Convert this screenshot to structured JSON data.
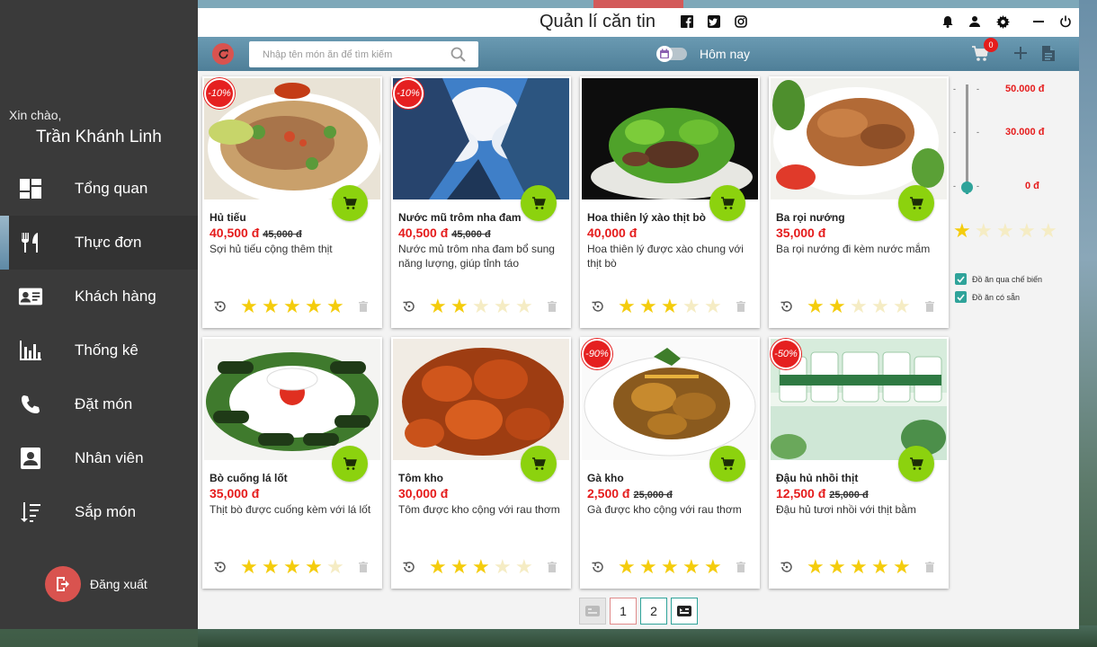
{
  "app": {
    "title": "Quản lí căn tin"
  },
  "user": {
    "greeting": "Xin chào,",
    "name": "Trần Khánh Linh"
  },
  "nav": [
    {
      "label": "Tổng quan",
      "icon": "dashboard-icon"
    },
    {
      "label": "Thực đơn",
      "icon": "restaurant-icon"
    },
    {
      "label": "Khách hàng",
      "icon": "contact-card-icon"
    },
    {
      "label": "Thống kê",
      "icon": "bar-chart-icon"
    },
    {
      "label": "Đặt món",
      "icon": "phone-icon"
    },
    {
      "label": "Nhân viên",
      "icon": "employee-icon"
    },
    {
      "label": "Sắp món",
      "icon": "sort-icon"
    }
  ],
  "logout": {
    "label": "Đăng xuất"
  },
  "toolbar": {
    "search_placeholder": "Nhập tên món ăn để tìm kiếm",
    "date_label": "Hôm nay",
    "cart_count": "0"
  },
  "items": [
    {
      "name": "Hủ tiếu",
      "price": "40,500 đ",
      "old_price": "45,000 đ",
      "discount": "-10%",
      "desc": "Sợi hủ tiếu cộng thêm thịt",
      "rating": 5
    },
    {
      "name": "Nước mũ trôm nha đam",
      "price": "40,500 đ",
      "old_price": "45,000 đ",
      "discount": "-10%",
      "desc": "Nước mủ trôm nha đam bổ sung năng lượng, giúp tỉnh táo",
      "rating": 2
    },
    {
      "name": "Hoa thiên lý xào thịt bò",
      "price": "40,000 đ",
      "old_price": "",
      "discount": "",
      "desc": "Hoa thiên lý được xào chung với thịt bò",
      "rating": 3
    },
    {
      "name": "Ba rọi nướng",
      "price": "35,000 đ",
      "old_price": "",
      "discount": "",
      "desc": "Ba rọi nướng đi kèm nước mắm",
      "rating": 2
    },
    {
      "name": "Bò cuống lá lốt",
      "price": "35,000 đ",
      "old_price": "",
      "discount": "",
      "desc": "Thịt bò được cuống kèm với lá lốt",
      "rating": 4
    },
    {
      "name": "Tôm kho",
      "price": "30,000 đ",
      "old_price": "",
      "discount": "",
      "desc": "Tôm được kho cộng với rau thơm",
      "rating": 3
    },
    {
      "name": "Gà kho",
      "price": "2,500 đ",
      "old_price": "25,000 đ",
      "discount": "-90%",
      "desc": "Gà được kho cộng với rau thơm",
      "rating": 5
    },
    {
      "name": "Đậu hủ nhồi thịt",
      "price": "12,500 đ",
      "old_price": "25,000 đ",
      "discount": "-50%",
      "desc": "Đậu hủ tươi nhồi với thịt bằm",
      "rating": 5
    }
  ],
  "filter": {
    "price_labels": [
      "50.000 đ",
      "30.000 đ",
      "0 đ"
    ],
    "tick_marks": [
      "-",
      "-",
      "-",
      "-",
      "-",
      "-"
    ],
    "min_rating": 1,
    "checkboxes": [
      {
        "label": "Đồ ăn qua chế biến",
        "checked": true
      },
      {
        "label": "Đồ ăn có sẵn",
        "checked": true
      }
    ]
  },
  "pagination": {
    "pages": [
      "1",
      "2"
    ],
    "current": "1"
  },
  "colors": {
    "accent": "#2fa39a",
    "price": "#e51c1c",
    "cart_button": "#8cd20e",
    "star": "#f4cc0c"
  }
}
